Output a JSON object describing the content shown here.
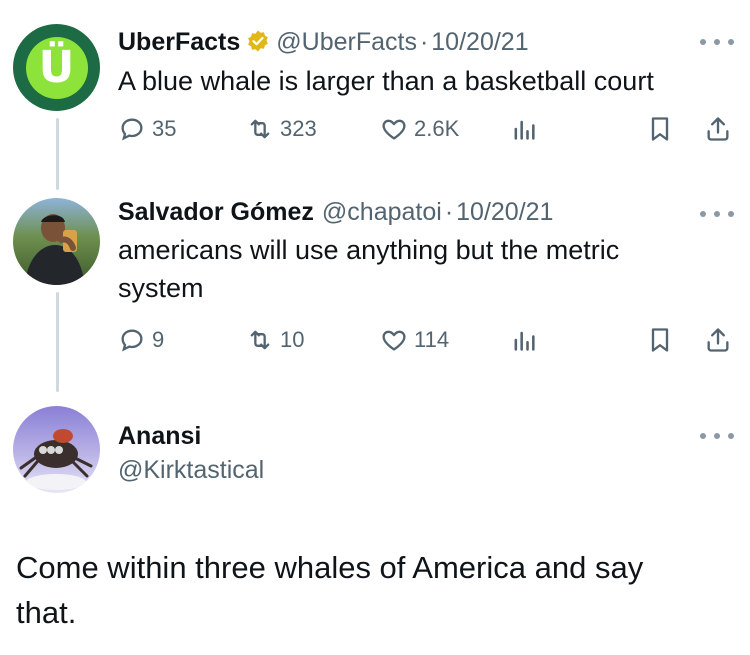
{
  "tweets": [
    {
      "name": "UberFacts",
      "handle": "@UberFacts",
      "dot": "·",
      "date": "10/20/21",
      "text": "A blue whale is larger than a basketball court",
      "replies": "35",
      "retweets": "323",
      "likes": "2.6K",
      "verified": true,
      "avatar_letter": "Ü",
      "avatar_color": "#1c6b45",
      "avatar_accent": "#8de33a"
    },
    {
      "name": "Salvador Gómez",
      "handle": "@chapatoi",
      "dot": "·",
      "date": "10/20/21",
      "text_line1": "americans will use anything but the metric",
      "text_line2": "system",
      "replies": "9",
      "retweets": "10",
      "likes": "114"
    },
    {
      "name": "Anansi",
      "handle": "@Kirktastical",
      "text_line1": "Come within three whales of America and say",
      "text_line2": "that."
    }
  ],
  "icons": {
    "reply": "reply-icon",
    "retweet": "retweet-icon",
    "like": "like-icon",
    "views": "views-icon",
    "bookmark": "bookmark-icon",
    "share": "share-icon",
    "more": "more-icon"
  },
  "colors": {
    "text": "#0f1419",
    "secondary": "#536471",
    "verified_gold": "#e2b719",
    "thread_line": "#cfd9de"
  }
}
